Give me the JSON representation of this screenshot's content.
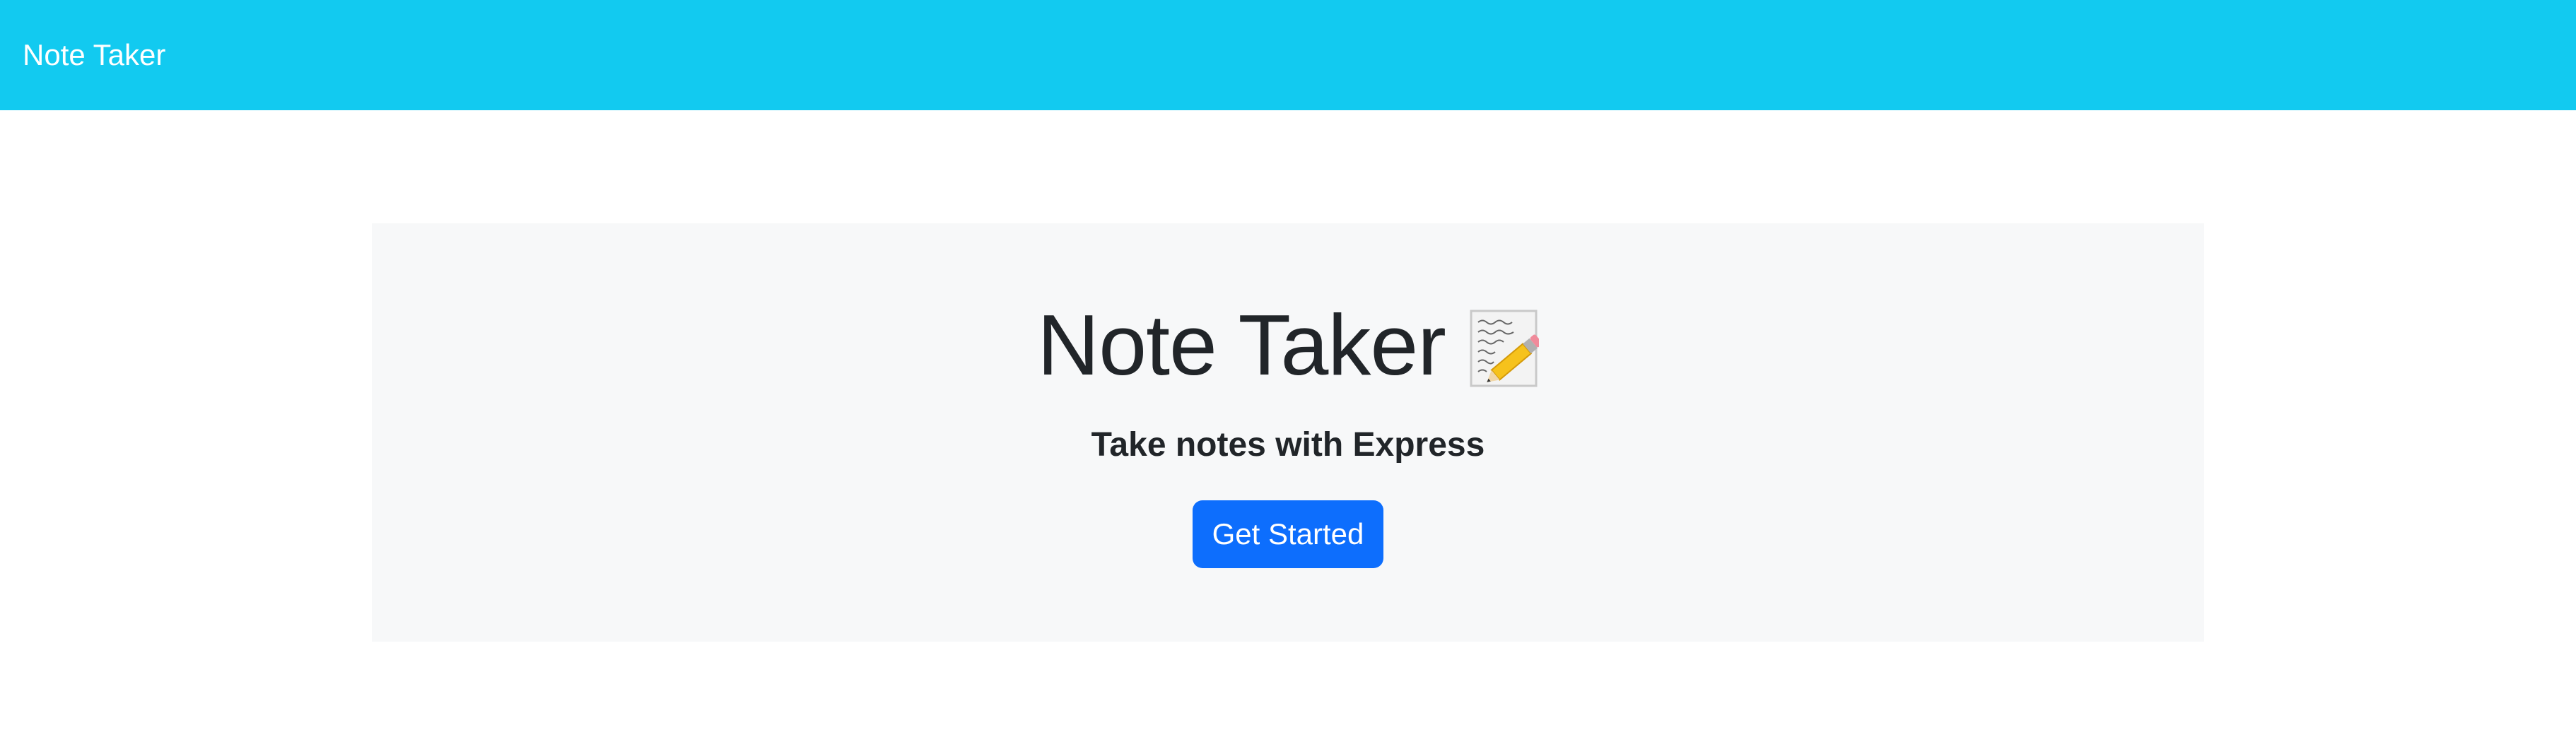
{
  "navbar": {
    "brand": "Note Taker",
    "background_color": "#12caf0"
  },
  "hero": {
    "title": "Note Taker",
    "title_icon": "memo-icon",
    "subtitle": "Take notes with Express",
    "cta_label": "Get Started",
    "cta_color": "#0d6efd"
  }
}
